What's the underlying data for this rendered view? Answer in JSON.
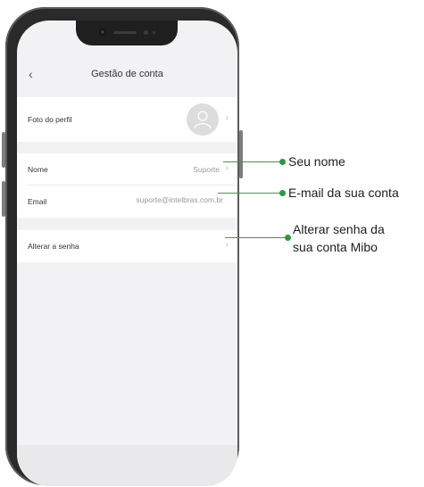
{
  "header": {
    "title": "Gestão de conta",
    "back_icon": "chevron-left-icon"
  },
  "account": {
    "photo_label": "Foto do perfil",
    "name_label": "Nome",
    "name_value": "Suporte",
    "email_label": "Email",
    "email_value": "suporte@intelbras.com.br",
    "password_label": "Alterar a senha"
  },
  "callouts": {
    "name": "Seu nome",
    "email": "E-mail da sua conta",
    "password_line1": "Alterar senha da",
    "password_line2": "sua conta Mibo"
  },
  "colors": {
    "accent": "#2a9a3c",
    "background": "#f2f2f4"
  },
  "icons": {
    "chevron": "chevron-right-icon",
    "avatar": "user-icon"
  }
}
